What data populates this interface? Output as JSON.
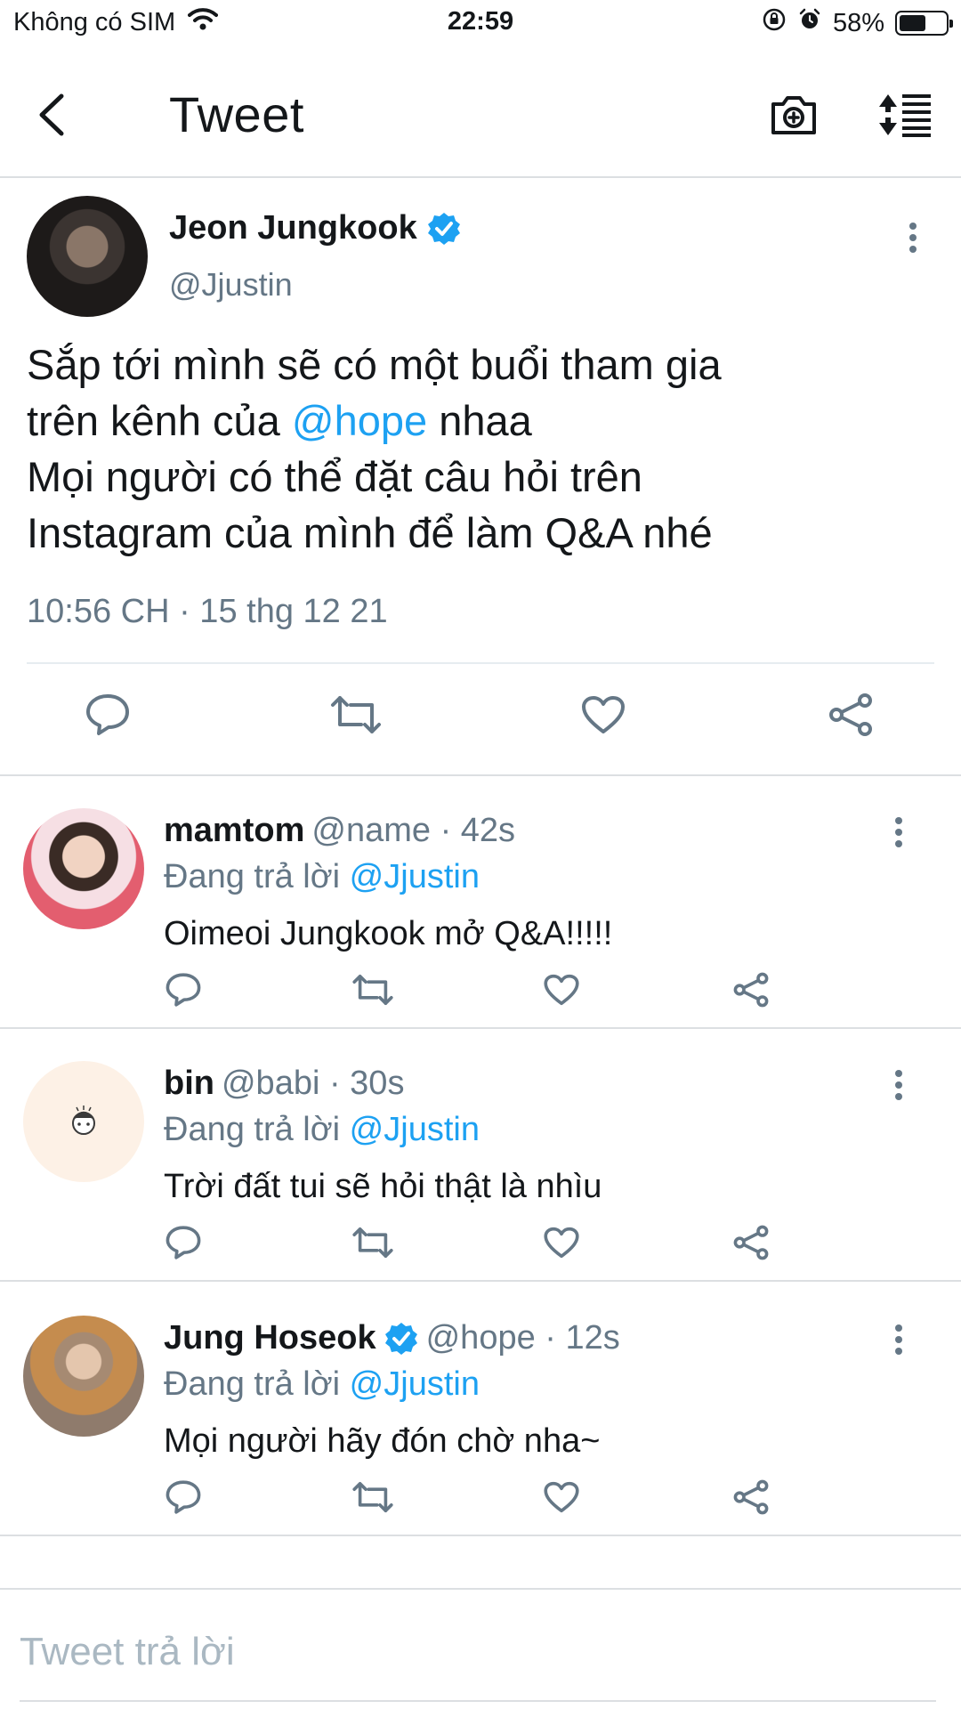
{
  "status_bar": {
    "carrier": "Không có SIM",
    "time": "22:59",
    "battery_percent": "58%",
    "battery_level": 0.58,
    "icons": [
      "wifi-icon",
      "orientation-lock-icon",
      "alarm-icon",
      "battery-icon"
    ]
  },
  "header": {
    "title": "Tweet",
    "icons": [
      "back-arrow-icon",
      "camera-icon",
      "sort-icon"
    ]
  },
  "main_tweet": {
    "author_name": "Jeon Jungkook",
    "handle": "@Jjustin",
    "verified": true,
    "text_line1": "Sắp tới mình sẽ có một buổi tham gia",
    "text_line2_before": "trên kênh của",
    "text_line2_mention": "@hope",
    "text_line2_after": "nhaa",
    "text_line3": "Mọi người có thể đặt câu hỏi trên",
    "text_line4": "Instagram của mình để làm Q&A nhé",
    "timestamp": "10:56 CH · 15 thg 12 21",
    "actions": [
      "reply-icon",
      "retweet-icon",
      "like-icon",
      "share-icon"
    ]
  },
  "replies": [
    {
      "name": "mamtom",
      "meta": "@name · 42s",
      "verified": false,
      "replying_prefix": "Đang trả lời",
      "replying_to": "@Jjustin",
      "text": "Oimeoi Jungkook mở Q&A!!!!!"
    },
    {
      "name": "bin",
      "meta": "@babi · 30s",
      "verified": false,
      "replying_prefix": "Đang trả lời",
      "replying_to": "@Jjustin",
      "text": "Trời đất tui sẽ hỏi thật là nhìu"
    },
    {
      "name": "Jung Hoseok",
      "meta": "@hope · 12s",
      "verified": true,
      "replying_prefix": "Đang trả lời",
      "replying_to": "@Jjustin",
      "text": "Mọi người hãy đón chờ nha~"
    }
  ],
  "reply_box": {
    "placeholder": "Tweet trả lời",
    "value": ""
  },
  "colors": {
    "accent": "#1da1f2",
    "text": "#14171a",
    "secondary": "#657786",
    "divider": "#dcdfe2"
  }
}
